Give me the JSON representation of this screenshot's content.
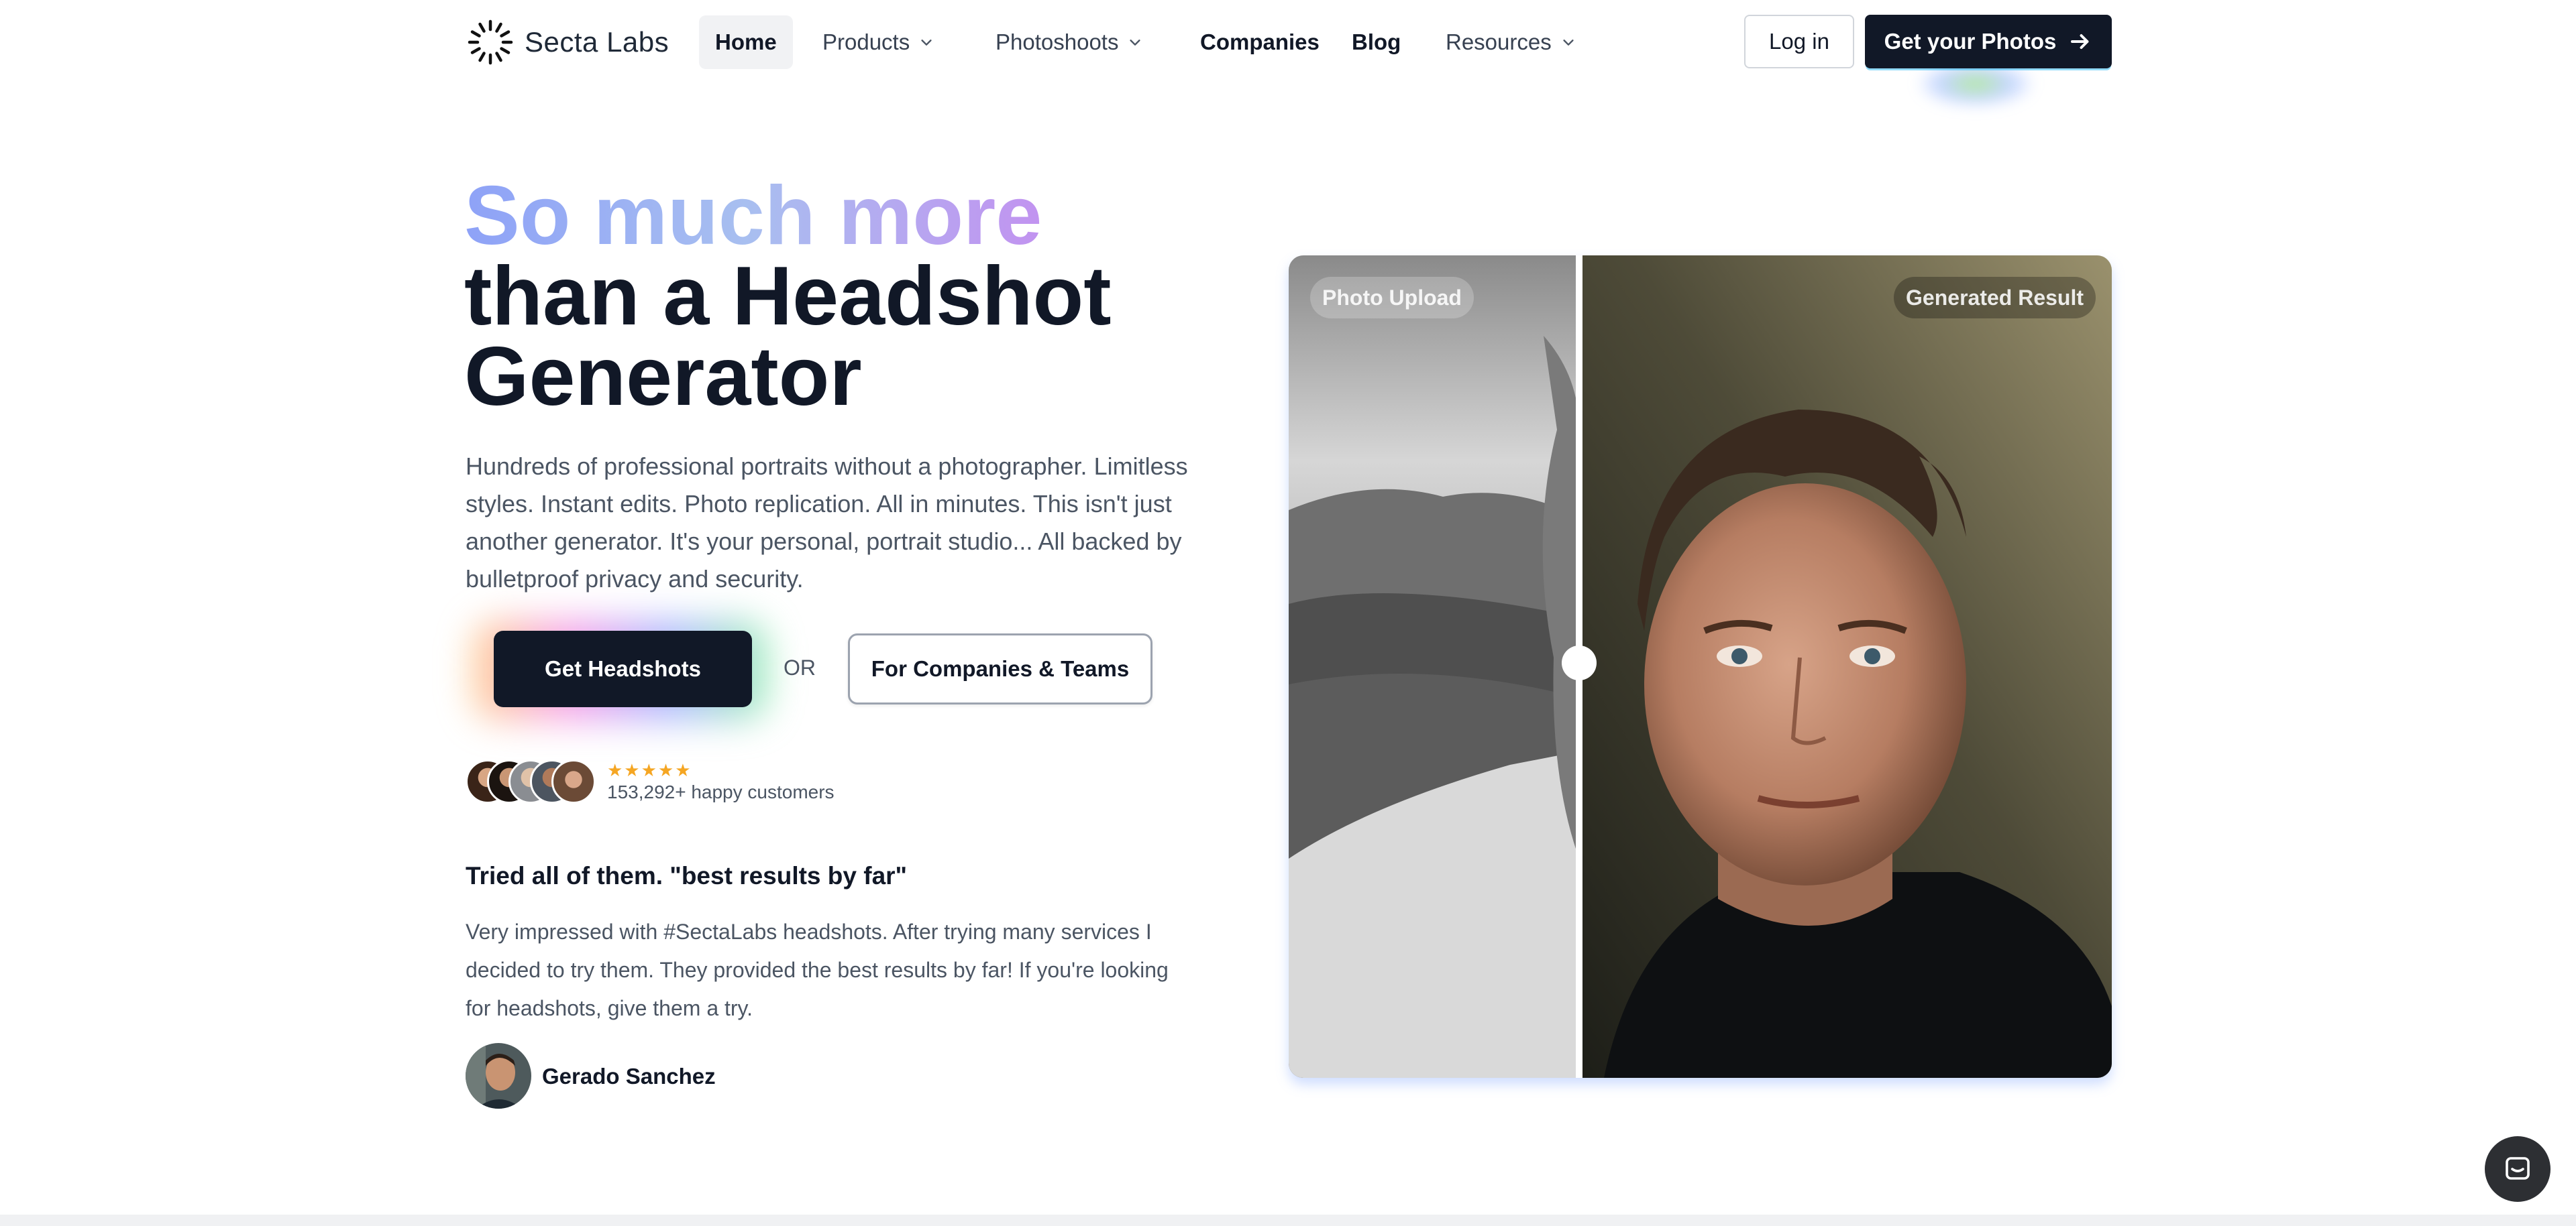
{
  "brand": {
    "name": "Secta Labs"
  },
  "nav": {
    "items": [
      {
        "label": "Home"
      },
      {
        "label": "Products"
      },
      {
        "label": "Photoshoots"
      },
      {
        "label": "Companies"
      },
      {
        "label": "Blog"
      },
      {
        "label": "Resources"
      }
    ],
    "login_label": "Log in",
    "cta_label": "Get your Photos"
  },
  "hero": {
    "title_gradient": "So much more",
    "title_line2": "than a Headshot",
    "title_line3": "Generator",
    "description": "Hundreds of professional portraits without a photographer. Limitless styles. Instant edits. Photo replication. All in minutes. This isn't just another generator. It's your personal, portrait studio... All backed by bulletproof privacy and security.",
    "primary_cta": "Get Headshots",
    "or_text": "OR",
    "secondary_cta": "For Companies & Teams",
    "rating_stars": "★★★★★",
    "customers_text": "153,292+ happy customers"
  },
  "review": {
    "title": "Tried all of them. \"best results by far\"",
    "body": "Very impressed with #SectaLabs headshots. After trying many services I decided to try them. They provided the best results by far! If you're looking for headshots, give them a try.",
    "author": "Gerado Sanchez"
  },
  "compare": {
    "left_label": "Photo Upload",
    "right_label": "Generated Result"
  },
  "colors": {
    "primary_dark": "#111827",
    "gradient_start": "#8ea2f7",
    "gradient_end": "#c77ee6",
    "star": "#f5a623"
  },
  "icons": [
    "secta-logo-icon",
    "chevron-down-icon",
    "arrow-right-icon",
    "chat-icon"
  ]
}
